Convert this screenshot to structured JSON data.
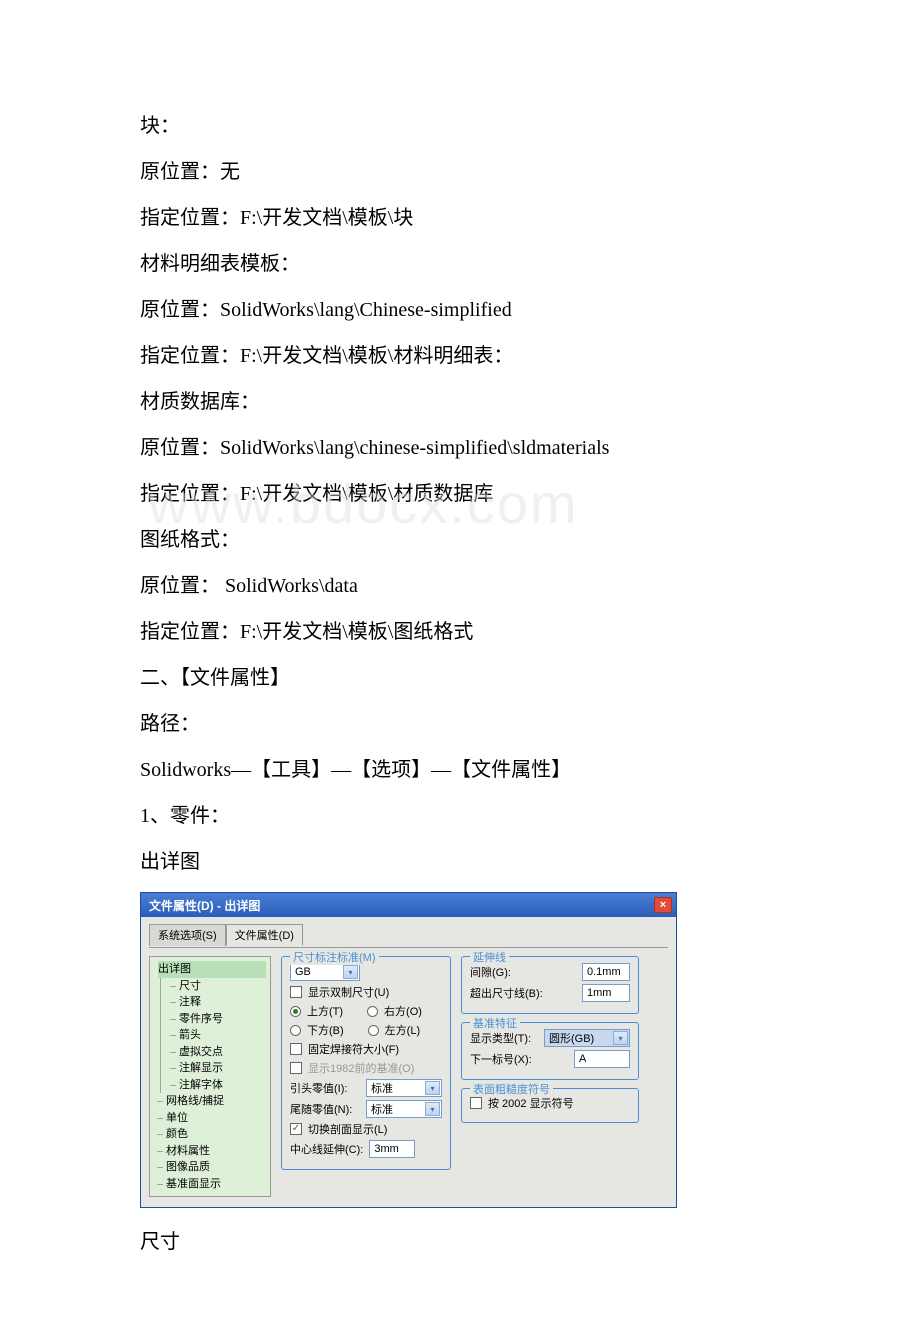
{
  "doc": {
    "lines": [
      "块：",
      "原位置：无",
      "指定位置：F:\\开发文档\\模板\\块",
      "材料明细表模板：",
      "原位置：SolidWorks\\lang\\Chinese-simplified",
      "指定位置：F:\\开发文档\\模板\\材料明细表：",
      "材质数据库：",
      "原位置：SolidWorks\\lang\\chinese-simplified\\sldmaterials",
      "指定位置：F:\\开发文档\\模板\\材质数据库",
      "图纸格式：",
      "原位置： SolidWorks\\data",
      "指定位置：F:\\开发文档\\模板\\图纸格式",
      "二、【文件属性】",
      "路径：",
      "Solidworks—【工具】—【选项】—【文件属性】",
      "1、零件：",
      "出详图"
    ],
    "footer": "尺寸"
  },
  "watermark": "www.bdocx.com",
  "dialog": {
    "title": "文件属性(D) - 出详图",
    "tabs": {
      "sys": "系统选项(S)",
      "doc": "文件属性(D)"
    },
    "tree": {
      "root": "出详图",
      "items": [
        "尺寸",
        "注释",
        "零件序号",
        "箭头",
        "虚拟交点",
        "注解显示",
        "注解字体",
        "网格线/捕捉",
        "单位",
        "颜色",
        "材料属性",
        "图像品质",
        "基准面显示"
      ]
    },
    "std": {
      "legend": "尺寸标注标准(M)",
      "gb": "GB",
      "dual": "显示双制尺寸(U)",
      "top": "上方(T)",
      "right": "右方(O)",
      "bottom": "下方(B)",
      "left": "左方(L)",
      "weld": "固定焊接符大小(F)",
      "oldbase": "显示1982前的基准(O)",
      "leadzero_l": "引头零值(I):",
      "leadzero_v": "标准",
      "trailzero_l": "尾随零值(N):",
      "trailzero_v": "标准",
      "section": "切换剖面显示(L)",
      "centerext_l": "中心线延伸(C):",
      "centerext_v": "3mm"
    },
    "ext": {
      "legend": "延伸线",
      "gap_l": "间隙(G):",
      "gap_v": "0.1mm",
      "beyond_l": "超出尺寸线(B):",
      "beyond_v": "1mm"
    },
    "datum": {
      "legend": "基准特征",
      "type_l": "显示类型(T):",
      "type_v": "圆形(GB)",
      "next_l": "下一标号(X):",
      "next_v": "A"
    },
    "surf": {
      "legend": "表面粗糙度符号",
      "by2002": "按 2002 显示符号"
    }
  }
}
